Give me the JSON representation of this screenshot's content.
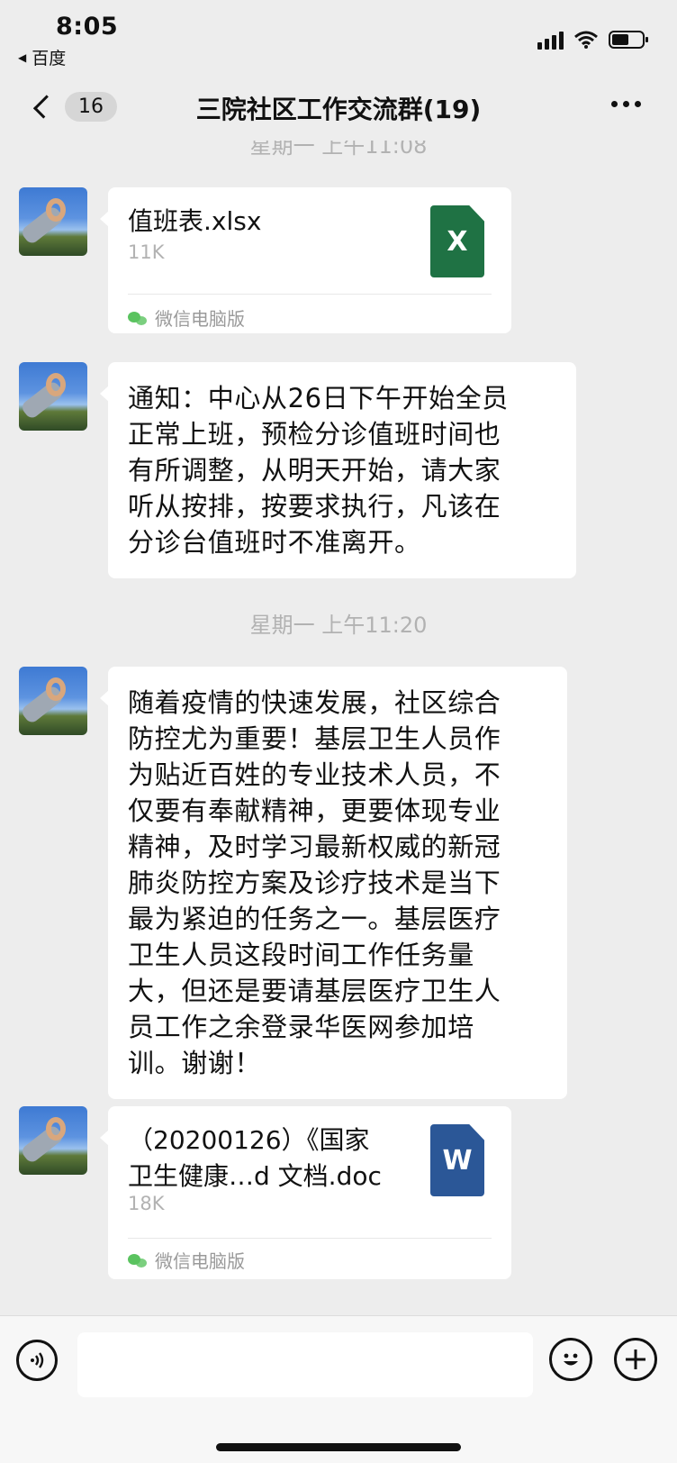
{
  "status_bar": {
    "time": "8:05",
    "back_app": "百度"
  },
  "nav": {
    "unread_badge": "16",
    "title": "三院社区工作交流群(19)"
  },
  "chat": {
    "timestamps": [
      "星期一 上午11:08",
      "星期一 上午11:20"
    ],
    "messages": [
      {
        "type": "file",
        "file_name": "值班表.xlsx",
        "file_size": "11K",
        "file_icon_letter": "X",
        "source": "微信电脑版"
      },
      {
        "type": "text",
        "text": "通知：中心从26日下午开始全员\n正常上班，预检分诊值班时间也\n有所调整，从明天开始，请大家\n听从按排，按要求执行，凡该在\n分诊台值班时不准离开。"
      },
      {
        "type": "text",
        "text": "随着疫情的快速发展，社区综合\n防控尤为重要！基层卫生人员作\n为贴近百姓的专业技术人员，不\n仅要有奉献精神，更要体现专业\n精神，及时学习最新权威的新冠\n肺炎防控方案及诊疗技术是当下\n最为紧迫的任务之一。基层医疗\n卫生人员这段时间工作任务量\n大，但还是要请基层医疗卫生人\n员工作之余登录华医网参加培\n训。谢谢！"
      },
      {
        "type": "file",
        "file_name": "（20200126）《国家\n卫生健康…d 文档.doc",
        "file_size": "18K",
        "file_icon_letter": "W",
        "source": "微信电脑版"
      }
    ]
  },
  "input_bar": {
    "placeholder": ""
  },
  "icons": {
    "voice": "voice-icon",
    "emoji": "emoji-icon",
    "plus": "plus-icon"
  },
  "colors": {
    "background": "#ededed",
    "bubble": "#ffffff",
    "xlsx_icon": "#1f7244",
    "doc_icon": "#2b5797",
    "wechat_green": "#5ac35f"
  }
}
